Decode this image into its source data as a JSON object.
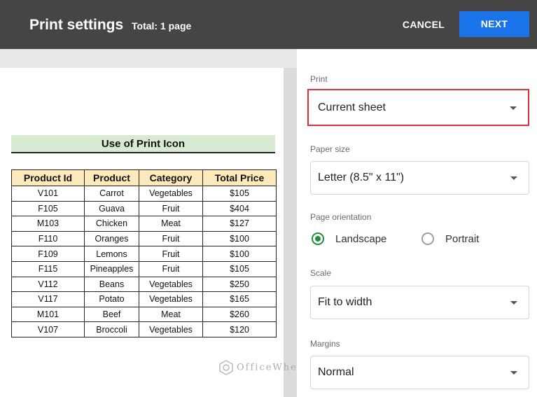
{
  "header": {
    "title": "Print settings",
    "total": "Total: 1 page",
    "cancel_label": "CANCEL",
    "next_label": "NEXT"
  },
  "sheet": {
    "title": "Use of Print Icon",
    "columns": [
      "Product Id",
      "Product",
      "Category",
      "Total Price"
    ],
    "rows": [
      [
        "V101",
        "Carrot",
        "Vegetables",
        "$105"
      ],
      [
        "F105",
        "Guava",
        "Fruit",
        "$404"
      ],
      [
        "M103",
        "Chicken",
        "Meat",
        "$127"
      ],
      [
        "F110",
        "Oranges",
        "Fruit",
        "$100"
      ],
      [
        "F109",
        "Lemons",
        "Fruit",
        "$100"
      ],
      [
        "F115",
        "Pineapples",
        "Fruit",
        "$105"
      ],
      [
        "V112",
        "Beans",
        "Vegetables",
        "$250"
      ],
      [
        "V117",
        "Potato",
        "Vegetables",
        "$165"
      ],
      [
        "M101",
        "Beef",
        "Meat",
        "$260"
      ],
      [
        "V107",
        "Broccoli",
        "Vegetables",
        "$120"
      ]
    ]
  },
  "watermark": "OfficeWheel",
  "settings": {
    "print": {
      "label": "Print",
      "value": "Current sheet"
    },
    "paper_size": {
      "label": "Paper size",
      "value": "Letter (8.5\" x 11\")"
    },
    "orientation": {
      "label": "Page orientation",
      "options": [
        "Landscape",
        "Portrait"
      ],
      "selected": "Landscape"
    },
    "scale": {
      "label": "Scale",
      "value": "Fit to width"
    },
    "margins": {
      "label": "Margins",
      "value": "Normal"
    }
  },
  "colors": {
    "header_bg": "#454545",
    "next_button": "#1a73e8",
    "highlight_border": "#d9313b",
    "radio_checked": "#1e8e3e",
    "title_band": "#d9ead3",
    "table_header": "#fde9b9"
  }
}
